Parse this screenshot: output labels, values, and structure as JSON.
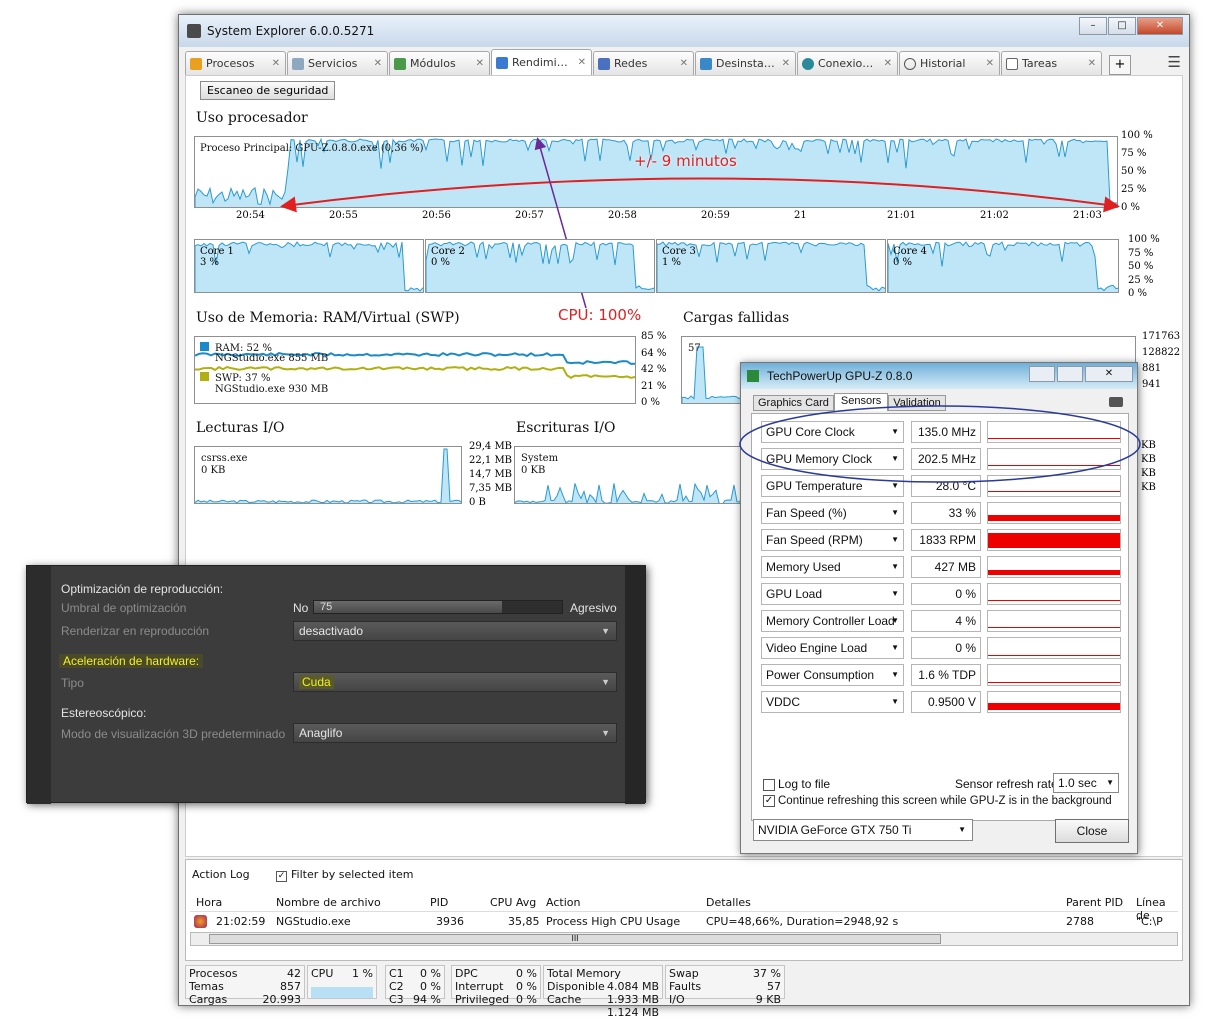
{
  "window": {
    "title": "System Explorer 6.0.0.5271",
    "controls": [
      "–",
      "□",
      "✕"
    ]
  },
  "tabs": [
    {
      "label": "Procesos"
    },
    {
      "label": "Servicios"
    },
    {
      "label": "Módulos"
    },
    {
      "label": "Rendimi…"
    },
    {
      "label": "Redes"
    },
    {
      "label": "Desinsta…"
    },
    {
      "label": "Conexio…"
    },
    {
      "label": "Historial"
    },
    {
      "label": "Tareas"
    }
  ],
  "active_tab": "Rendimi…",
  "toolbar": {
    "scan_button": "Escaneo de seguridad",
    "add_tab": "+",
    "menu": "☰"
  },
  "cpu": {
    "title": "Uso procesador",
    "main_process": "Proceso Principal: GPU-Z.0.8.0.exe (0,36 %)",
    "times": [
      "20:54",
      "20:55",
      "20:56",
      "20:57",
      "20:58",
      "20:59",
      "21",
      "21:01",
      "21:02",
      "21:03"
    ],
    "pct_ticks": [
      "100 %",
      "75 %",
      "50 %",
      "25 %",
      "0 %"
    ],
    "cores": [
      {
        "name": "Core 1",
        "value": "3 %"
      },
      {
        "name": "Core 2",
        "value": "0 %"
      },
      {
        "name": "Core 3",
        "value": "1 %"
      },
      {
        "name": "Core 4",
        "value": "0 %"
      }
    ],
    "core_ticks": [
      "100 %",
      "75 %",
      "50 %",
      "25 %",
      "0 %"
    ]
  },
  "annotations": {
    "minutes": "+/- 9 minutos",
    "cpu100": "CPU: 100%"
  },
  "memory": {
    "title": "Uso de Memoria: RAM/Virtual (SWP)",
    "ram": "RAM: 52 %",
    "ram_proc": "NGStudio.exe 855 MB",
    "swp": "SWP: 37 %",
    "swp_proc": "NGStudio.exe 930 MB",
    "ticks": [
      "85 %",
      "64 %",
      "42 %",
      "21 %",
      "0 %"
    ],
    "ram_color": "#1a8ac8",
    "swp_color": "#b0b010"
  },
  "faults": {
    "title": "Cargas fallidas",
    "label": "57",
    "ticks": [
      "171763",
      "128822",
      "881",
      "941"
    ]
  },
  "io_read": {
    "title": "Lecturas I/O",
    "proc": "csrss.exe",
    "value": "0 KB",
    "ticks": [
      "29,4 MB",
      "22,1 MB",
      "14,7 MB",
      "7,35 MB",
      "0 B"
    ]
  },
  "io_write": {
    "title": "Escrituras I/O",
    "proc": "System",
    "value": "0 KB",
    "ticks": [
      "KB",
      "KB",
      "KB",
      "KB"
    ]
  },
  "action_log": {
    "title": "Action Log",
    "filter": "Filter by selected item",
    "columns": [
      "Hora",
      "Nombre de archivo",
      "PID",
      "CPU Avg",
      "Action",
      "Detalles",
      "Parent PID",
      "Línea de"
    ],
    "rows": [
      {
        "hora": "21:02:59",
        "file": "NGStudio.exe",
        "pid": "3936",
        "cpu": "35,85",
        "action": "Process High CPU Usage",
        "details": "CPU=48,66%, Duration=2948,92 s",
        "ppid": "2788",
        "cmd": "\"C:\\P"
      }
    ],
    "scroll": "III"
  },
  "status": {
    "procesos_l": "Procesos",
    "procesos": "42",
    "temas_l": "Temas",
    "temas": "857",
    "cargas_l": "Cargas",
    "cargas": "20.993",
    "cpu_l": "CPU",
    "cpu": "1 %",
    "c1_l": "C1",
    "c1": "0 %",
    "c2_l": "C2",
    "c2": "0 %",
    "c3_l": "C3",
    "c3": "94 %",
    "dpc_l": "DPC",
    "dpc": "0 %",
    "int_l": "Interrupt",
    "int": "0 %",
    "priv_l": "Privileged",
    "priv": "0 %",
    "tm_l": "Total Memory",
    "tm": "4.084 MB",
    "disp_l": "Disponible",
    "disp": "1.933 MB",
    "cache_l": "Cache",
    "cache": "1.124 MB",
    "swap_l": "Swap",
    "swap": "37 %",
    "faults_l": "Faults",
    "faults": "57",
    "io_l": "I/O",
    "io": "9 KB"
  },
  "player": {
    "sec1": "Optimización de reproducción:",
    "umbral": "Umbral de optimización",
    "no": "No",
    "slider_value": "75",
    "agresivo": "Agresivo",
    "render": "Renderizar en reproducción",
    "render_val": "desactivado",
    "sec2": "Aceleración de hardware:",
    "tipo": "Tipo",
    "tipo_val": "Cuda",
    "sec3": "Estereoscópico:",
    "modo": "Modo de visualización 3D predeterminado",
    "modo_val": "Anaglifo",
    "slider_fraction": 0.75
  },
  "gpuz": {
    "title": "TechPowerUp GPU-Z 0.8.0",
    "tabs": [
      "Graphics Card",
      "Sensors",
      "Validation"
    ],
    "sensors": [
      {
        "name": "GPU Core Clock",
        "value": "135.0 MHz",
        "level": 0.05
      },
      {
        "name": "GPU Memory Clock",
        "value": "202.5 MHz",
        "level": 0.05
      },
      {
        "name": "GPU Temperature",
        "value": "28.0 °C",
        "level": 0.1
      },
      {
        "name": "Fan Speed (%)",
        "value": "33 %",
        "level": 0.3
      },
      {
        "name": "Fan Speed (RPM)",
        "value": "1833 RPM",
        "level": 0.85
      },
      {
        "name": "Memory Used",
        "value": "427 MB",
        "level": 0.25
      },
      {
        "name": "GPU Load",
        "value": "0 %",
        "level": 0.05
      },
      {
        "name": "Memory Controller Load",
        "value": "4 %",
        "level": 0.05
      },
      {
        "name": "Video Engine Load",
        "value": "0 %",
        "level": 0
      },
      {
        "name": "Power Consumption",
        "value": "1.6 % TDP",
        "level": 0
      },
      {
        "name": "VDDC",
        "value": "0.9500 V",
        "level": 0.4
      }
    ],
    "log": "Log to file",
    "refresh_label": "Sensor refresh rate:",
    "refresh": "1.0 sec",
    "continue": "Continue refreshing this screen while GPU-Z is in the background",
    "gpu": "NVIDIA GeForce GTX 750 Ti",
    "close": "Close"
  }
}
